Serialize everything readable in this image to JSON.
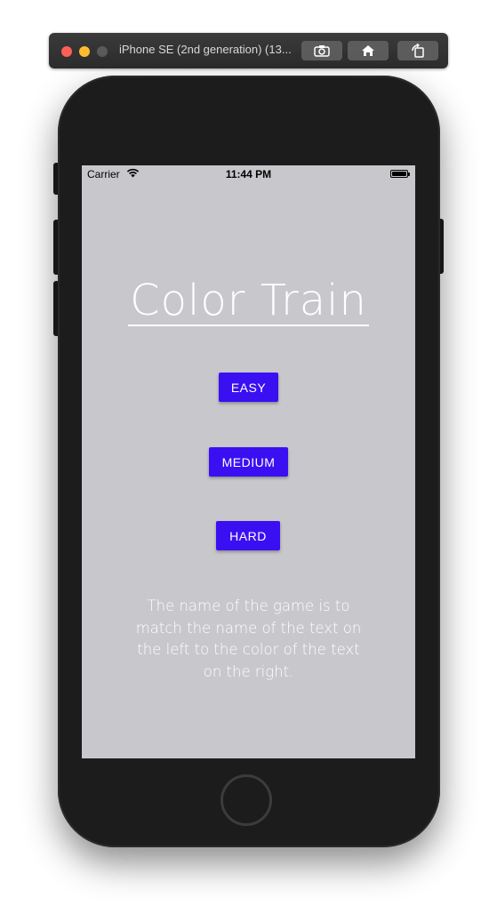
{
  "simulator": {
    "window_title": "iPhone SE (2nd generation) (13...",
    "toolbar_buttons": [
      "screenshot-icon",
      "home-icon",
      "rotate-icon"
    ]
  },
  "status_bar": {
    "carrier": "Carrier",
    "time": "11:44 PM"
  },
  "app": {
    "title": "Color Train",
    "buttons": {
      "easy": "EASY",
      "medium": "MEDIUM",
      "hard": "HARD"
    },
    "description": "The name of the game is to match the name of the text on the left to the color of the text on the right."
  },
  "colors": {
    "screen_background": "#c8c7cc",
    "button_background": "#3a10f2",
    "text": "#ffffff"
  }
}
